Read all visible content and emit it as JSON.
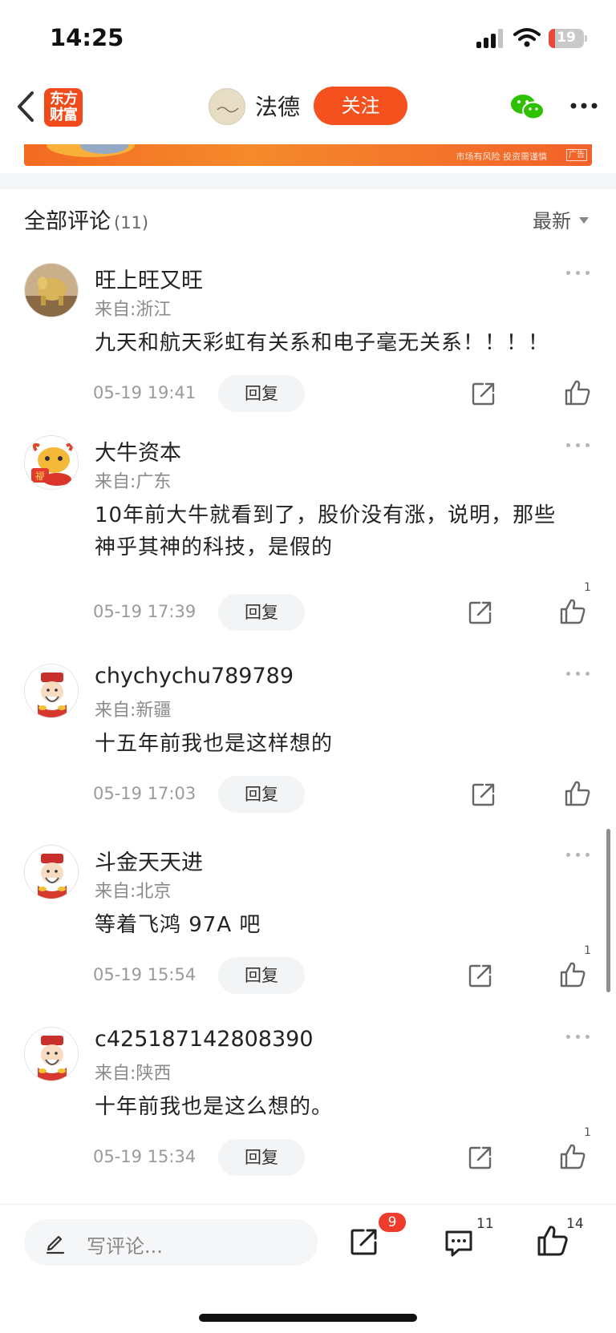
{
  "status_bar": {
    "time": "14:25",
    "battery_level": "19",
    "battery_fraction": 0.19,
    "battery_color": "#e8473c"
  },
  "nav": {
    "app_logo_line1": "东方",
    "app_logo_line2": "财富",
    "author_name": "法德",
    "follow_label": "关注",
    "accent_color": "#f4511e"
  },
  "ad": {
    "disclaimer": "市场有风险 投资需谨慎",
    "tag": "广告"
  },
  "comments_section": {
    "title": "全部评论",
    "count": "(11)",
    "sort_label": "最新"
  },
  "comments": [
    {
      "name": "旺上旺又旺",
      "location": "来自:浙江",
      "text": "九天和航天彩虹有关系和电子毫无关系！！！！",
      "time": "05-19 19:41",
      "reply_label": "回复",
      "likes": ""
    },
    {
      "name": "大牛资本",
      "location": "来自:广东",
      "text": "10年前大牛就看到了，股价没有涨，说明，那些神乎其神的科技，是假的",
      "time": "05-19 17:39",
      "reply_label": "回复",
      "likes": "1"
    },
    {
      "name": "chychychu789789",
      "location": "来自:新疆",
      "text": "十五年前我也是这样想的",
      "time": "05-19 17:03",
      "reply_label": "回复",
      "likes": ""
    },
    {
      "name": "斗金天天进",
      "location": "来自:北京",
      "text": "等着飞鸿 97A 吧",
      "time": "05-19 15:54",
      "reply_label": "回复",
      "likes": "1"
    },
    {
      "name": "c425187142808390",
      "location": "来自:陕西",
      "text": "十年前我也是这么想的。",
      "time": "05-19 15:34",
      "reply_label": "回复",
      "likes": "1"
    }
  ],
  "bottom_bar": {
    "write_placeholder": "写评论...",
    "share_badge": "9",
    "comment_count": "11",
    "like_count": "14"
  }
}
